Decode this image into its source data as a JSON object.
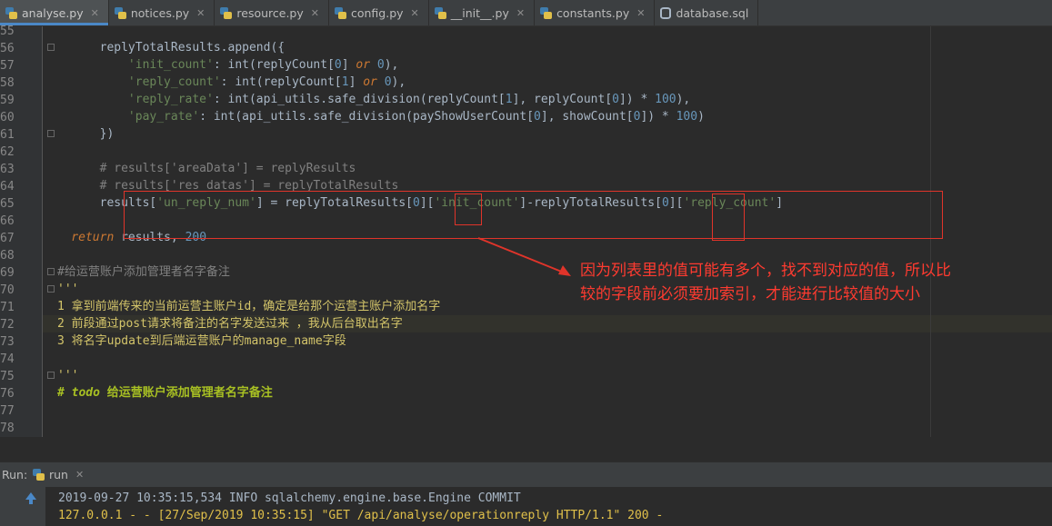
{
  "tabs": [
    {
      "label": "analyse.py",
      "icon": "python-file-icon",
      "active": true
    },
    {
      "label": "notices.py",
      "icon": "python-file-icon",
      "active": false
    },
    {
      "label": "resource.py",
      "icon": "python-file-icon",
      "active": false
    },
    {
      "label": "config.py",
      "icon": "python-file-icon",
      "active": false
    },
    {
      "label": "__init__.py",
      "icon": "python-file-icon",
      "active": false
    },
    {
      "label": "constants.py",
      "icon": "python-file-icon",
      "active": false
    },
    {
      "label": "database.sql",
      "icon": "sql-file-icon",
      "active": false
    }
  ],
  "line_numbers": [
    "55",
    "56",
    "57",
    "58",
    "59",
    "60",
    "61",
    "62",
    "63",
    "64",
    "65",
    "66",
    "67",
    "68",
    "69",
    "70",
    "71",
    "72",
    "73",
    "74",
    "75",
    "76",
    "77",
    "78"
  ],
  "code": {
    "l56": "        replyTotalResults.append({",
    "l57a": "            'init_count'",
    "l57b": ": int(replyCount[",
    "l57c": "0",
    "l57d": "] ",
    "l57e": "or",
    "l57f": " ",
    "l57g": "0",
    "l57h": "),",
    "l58a": "            'reply_count'",
    "l58b": ": int(replyCount[",
    "l58c": "1",
    "l58d": "] ",
    "l58e": "or",
    "l58f": " ",
    "l58g": "0",
    "l58h": "),",
    "l59a": "            'reply_rate'",
    "l59b": ": int(api_utils.safe_division(replyCount[",
    "l59c": "1",
    "l59d": "], replyCount[",
    "l59e": "0",
    "l59f": "]) * ",
    "l59g": "100",
    "l59h": "),",
    "l60a": "            'pay_rate'",
    "l60b": ": int(api_utils.safe_division(payShowUserCount[",
    "l60c": "0",
    "l60d": "], showCount[",
    "l60e": "0",
    "l60f": "]) * ",
    "l60g": "100",
    "l60h": ")",
    "l61": "        })",
    "l63": "        # results['areaData'] = replyResults",
    "l64": "        # results['res_datas'] = replyTotalResults",
    "l65a": "        results[",
    "l65b": "'un_reply_num'",
    "l65c": "] = replyTotalResults[",
    "l65d": "0",
    "l65e": "][",
    "l65f": "'init_count'",
    "l65g": "]-replyTotalResults[",
    "l65h": "0",
    "l65i": "][",
    "l65j": "'reply_count'",
    "l65k": "]",
    "l67a": "    return",
    "l67b": " results, ",
    "l67c": "200",
    "l69": "#给运营账户添加管理者名字备注",
    "l70": "'''",
    "l71": "1 拿到前端传来的当前运营主账户id，确定是给那个运营主账户添加名字",
    "l72": "2 前段通过post请求将备注的名字发送过来 ，我从后台取出名字",
    "l73": "3 将名字update到后端运营账户的manage_name字段",
    "l75": "'''",
    "l76a": "# ",
    "l76b": "todo",
    "l76c": " 给运营账户添加管理者名字备注"
  },
  "annotation": {
    "text_line1": "因为列表里的值可能有多个，找不到对应的值，所以比",
    "text_line2": "较的字段前必须要加索引，才能进行比较值的大小",
    "color": "#e0342a"
  },
  "run_panel": {
    "label": "Run:",
    "tab_label": "run",
    "log_line1": "2019-09-27 10:35:15,534 INFO sqlalchemy.engine.base.Engine COMMIT",
    "log_line2": "127.0.0.1 - - [27/Sep/2019 10:35:15] \"GET /api/analyse/operationreply HTTP/1.1\" 200 -"
  }
}
